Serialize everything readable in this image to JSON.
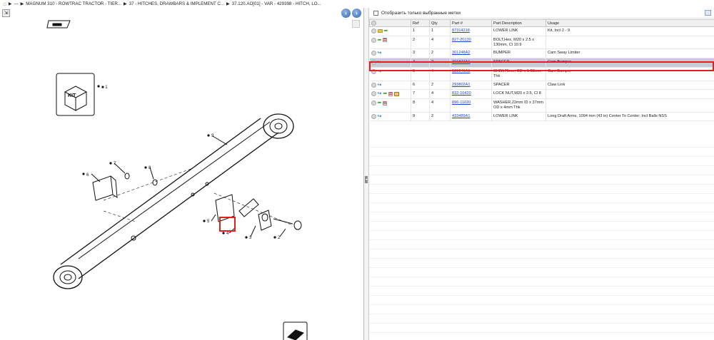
{
  "breadcrumb": {
    "items": [
      "---",
      "MAGNUM 310 - ROWTRAC TRACTOR - TIER...",
      "37 - HITCHES, DRAWBARS & IMPLEMENT C...",
      "37.120.AO[01] - VAR - 429398 - HITCH, LO..."
    ]
  },
  "diagram": {
    "callouts": [
      "1",
      "2",
      "3",
      "4",
      "5",
      "6",
      "7",
      "8",
      "9"
    ],
    "kit_label": "KIT"
  },
  "filter": {
    "label": "Отобразить только выбранные метки"
  },
  "table": {
    "headers": [
      "Ref",
      "Qty",
      "Part #",
      "Part Description",
      "Usage"
    ],
    "rows": [
      {
        "ref": "1",
        "qty": "1",
        "part": "87314218",
        "desc": "LOWER LINK",
        "usage": "Kit, Incl 2 - 9",
        "icons": [
          "option-icon",
          "folder-icon",
          "green-arrow-icon"
        ]
      },
      {
        "ref": "2",
        "qty": "4",
        "part": "827-20130",
        "desc": "BOLT,Hex, M20 x 2.5 x 130mm, Cl 10.9",
        "usage": "",
        "icons": [
          "option-icon",
          "green-arrow-icon",
          "list-icon"
        ]
      },
      {
        "ref": "3",
        "qty": "2",
        "part": "301248A2",
        "desc": "BUMPER",
        "usage": "Cam Sway Limiter",
        "icons": [
          "option-icon",
          "blue-arrow-icon"
        ]
      },
      {
        "ref": "4",
        "qty": "2",
        "part": "301827A1",
        "desc": "SPACER",
        "usage": "Cam Bumper",
        "icons": [
          "option-icon",
          "blue-arrow-icon"
        ],
        "selected": true
      },
      {
        "ref": "5",
        "qty": "4",
        "part": "189946A1",
        "desc": "SHIM,76mm OD x 1.03mm Thk",
        "usage": "Cam Bumper",
        "icons": [
          "option-icon",
          "blue-arrow-icon"
        ]
      },
      {
        "ref": "6",
        "qty": "2",
        "part": "293802A1",
        "desc": "SPACER",
        "usage": "Claw Link",
        "icons": [
          "option-icon",
          "blue-arrow-icon"
        ]
      },
      {
        "ref": "7",
        "qty": "4",
        "part": "832-10420",
        "desc": "LOCK NUT,M20 x 2.5, Cl 8",
        "usage": "",
        "icons": [
          "option-icon",
          "blue-arrow-icon",
          "green-arrow-icon",
          "list-icon",
          "package-icon"
        ]
      },
      {
        "ref": "8",
        "qty": "4",
        "part": "896-11020",
        "desc": "WASHER,22mm ID x 37mm OD x 4mm Thk",
        "usage": "",
        "icons": [
          "option-icon",
          "green-arrow-icon",
          "list-icon"
        ]
      },
      {
        "ref": "9",
        "qty": "2",
        "part": "433489A1",
        "desc": "LOWER LINK",
        "usage": "Long Draft Arms, 1094 mm (43 in) Center To Center; Incl Balls NSS",
        "icons": [
          "option-icon",
          "blue-arrow-icon"
        ]
      }
    ]
  },
  "colors": {
    "selection_row": "#c6ccd5",
    "highlight": "#e02020",
    "link": "#1f3fcf"
  }
}
